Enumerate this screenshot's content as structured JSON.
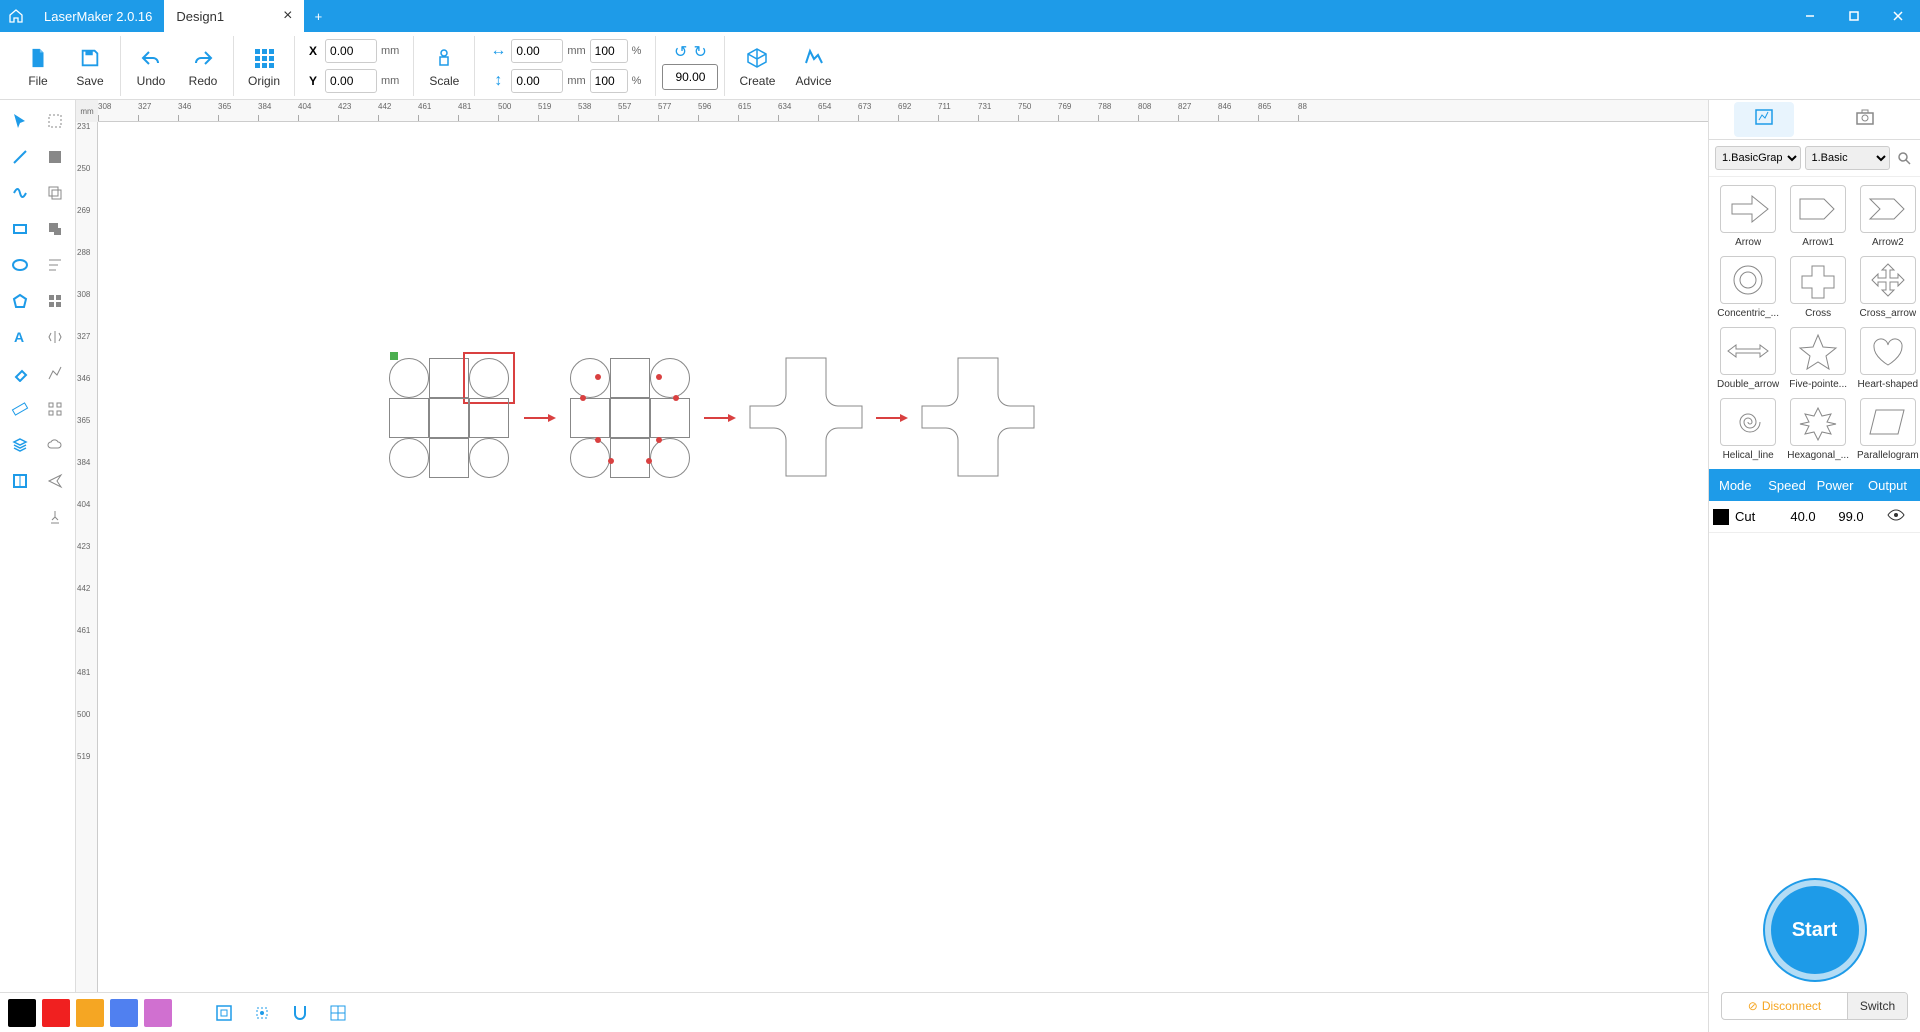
{
  "app": {
    "title": "LaserMaker 2.0.16"
  },
  "tabs": {
    "active": "Design1"
  },
  "toolbar": {
    "file": "File",
    "save": "Save",
    "undo": "Undo",
    "redo": "Redo",
    "origin": "Origin",
    "scale": "Scale",
    "create": "Create",
    "advice": "Advice"
  },
  "coords": {
    "x_label": "X",
    "x_val": "0.00",
    "y_label": "Y",
    "y_val": "0.00",
    "w_val": "0.00",
    "h_val": "0.00",
    "w_pct": "100",
    "h_pct": "100",
    "rotate": "90.00",
    "mm": "mm",
    "pct": "%"
  },
  "ruler_h": [
    "308",
    "327",
    "346",
    "365",
    "384",
    "404",
    "423",
    "442",
    "461",
    "481",
    "500",
    "519",
    "538",
    "557",
    "577",
    "596",
    "615",
    "634",
    "654",
    "673",
    "692",
    "711",
    "731",
    "750",
    "769",
    "788",
    "808",
    "827",
    "846",
    "865",
    "88"
  ],
  "ruler_v": [
    "231",
    "250",
    "269",
    "288",
    "308",
    "327",
    "346",
    "365",
    "384",
    "404",
    "423",
    "442",
    "461",
    "481",
    "500",
    "519"
  ],
  "ruler_unit": "mm",
  "right": {
    "cat1": "1.BasicGrap",
    "cat2": "1.Basic",
    "shapes": [
      "Arrow",
      "Arrow1",
      "Arrow2",
      "Concentric_...",
      "Cross",
      "Cross_arrow",
      "Double_arrow",
      "Five-pointe...",
      "Heart-shaped",
      "Helical_line",
      "Hexagonal_...",
      "Parallelogram"
    ]
  },
  "layers": {
    "mode_h": "Mode",
    "speed_h": "Speed",
    "power_h": "Power",
    "output_h": "Output",
    "row": {
      "mode": "Cut",
      "speed": "40.0",
      "power": "99.0"
    }
  },
  "start": "Start",
  "conn": {
    "status": "Disconnect",
    "switch": "Switch"
  },
  "colors": [
    "#000000",
    "#f02020",
    "#f5a623",
    "#5080f0",
    "#d070d0"
  ]
}
